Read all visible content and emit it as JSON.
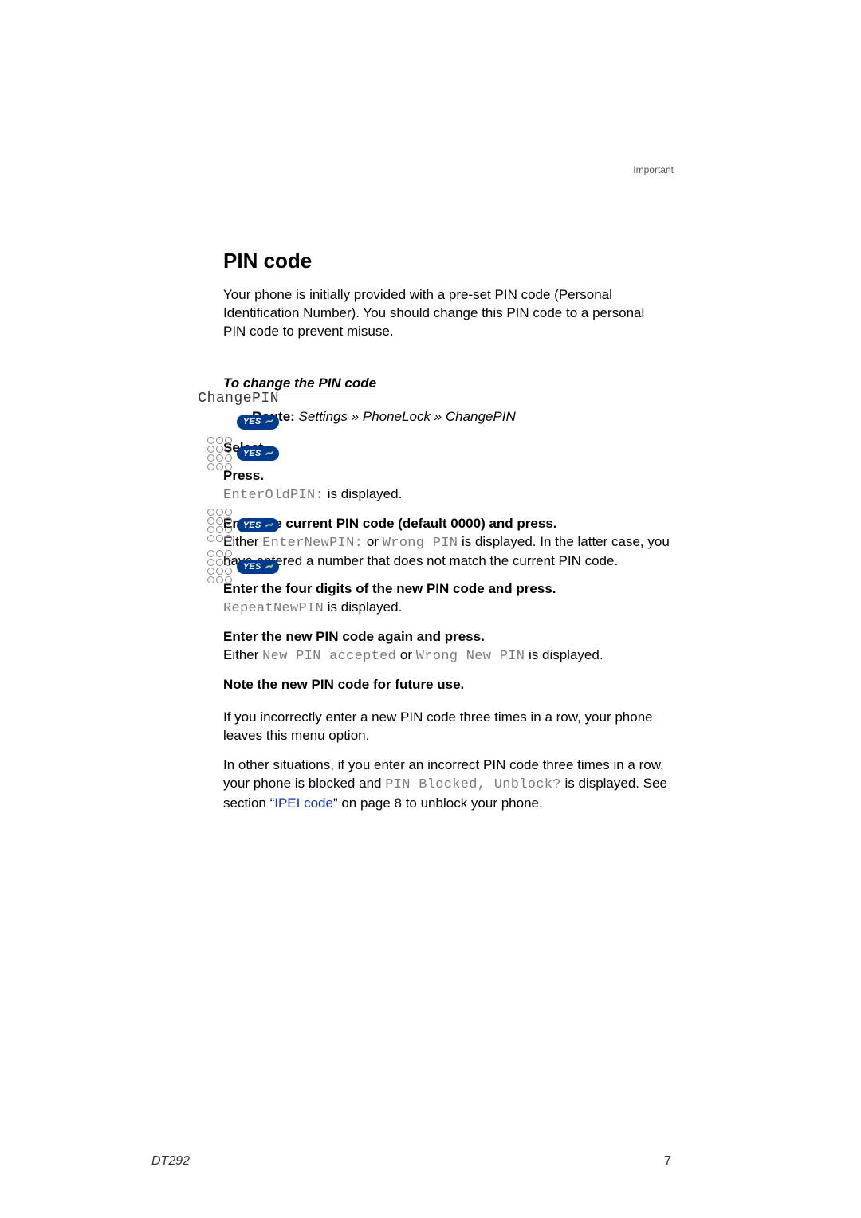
{
  "header": {
    "section_label": "Important"
  },
  "content": {
    "h1": "PIN code",
    "intro": "Your phone is initially provided with a pre-set PIN code (Personal Identification Number). You should change this PIN code to a personal PIN code to prevent misuse.",
    "subhead": "To change the PIN code",
    "route_label": "Route:",
    "route_path": " Settings » PhoneLock » ChangePIN",
    "left_changepin": "ChangePIN",
    "yes_label": "YES",
    "step_select": "Select.",
    "step_press": "Press.",
    "enter_old_pin": "EnterOldPIN:",
    "is_displayed_suffix": " is displayed.",
    "step_enter_current": "Enter the current PIN code (default 0000) and press.",
    "either_prefix": "Either ",
    "enter_new_pin": "EnterNewPIN:",
    "or_word": " or ",
    "wrong_pin": "Wrong PIN",
    "current_tail": " is displayed. In the latter case, you have entered a number that does not match the current PIN code.",
    "step_enter_four": "Enter the four digits of the new PIN code and press.",
    "repeat_new_pin": "RepeatNewPIN",
    "step_enter_again": "Enter the new PIN code again and press.",
    "new_pin_accepted": "New PIN accepted",
    "wrong_new_pin": "Wrong New PIN",
    "note_future": "Note the new PIN code for future use.",
    "para_incorrect": "If you incorrectly enter a new PIN code three times in a row, your phone leaves this menu option.",
    "para_other_pre": "In other situations, if you enter an incorrect PIN code three times in a row, your phone is blocked and ",
    "pin_blocked": "PIN Blocked, Unblock?",
    "para_other_mid": " is displayed. See section “",
    "ipei_link": "IPEI code",
    "para_other_post": "” on page 8 to unblock your phone."
  },
  "footer": {
    "model": "DT292",
    "page": "7"
  }
}
